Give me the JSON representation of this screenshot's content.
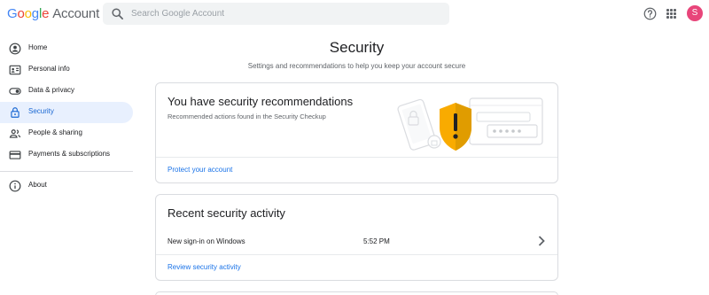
{
  "header": {
    "logo_google": [
      "G",
      "o",
      "o",
      "g",
      "l",
      "e"
    ],
    "logo_account": "Account",
    "search_placeholder": "Search Google Account",
    "avatar_letter": "S"
  },
  "sidebar": {
    "items": [
      {
        "label": "Home",
        "icon": "home-icon"
      },
      {
        "label": "Personal info",
        "icon": "person-card-icon"
      },
      {
        "label": "Data & privacy",
        "icon": "toggle-icon"
      },
      {
        "label": "Security",
        "icon": "lock-icon",
        "active": true
      },
      {
        "label": "People & sharing",
        "icon": "people-icon"
      },
      {
        "label": "Payments & subscriptions",
        "icon": "credit-card-icon"
      }
    ],
    "about_label": "About"
  },
  "main": {
    "title": "Security",
    "subtitle": "Settings and recommendations to help you keep your account secure",
    "recommendations": {
      "title": "You have security recommendations",
      "description": "Recommended actions found in the Security Checkup",
      "link": "Protect your account"
    },
    "activity": {
      "title": "Recent security activity",
      "event": "New sign-in on Windows",
      "time": "5:52 PM",
      "link": "Review security activity"
    }
  },
  "colors": {
    "accent": "#1a73e8",
    "active_bg": "#e8f0fe",
    "shield": "#f9ab00",
    "avatar": "#e8457a"
  }
}
